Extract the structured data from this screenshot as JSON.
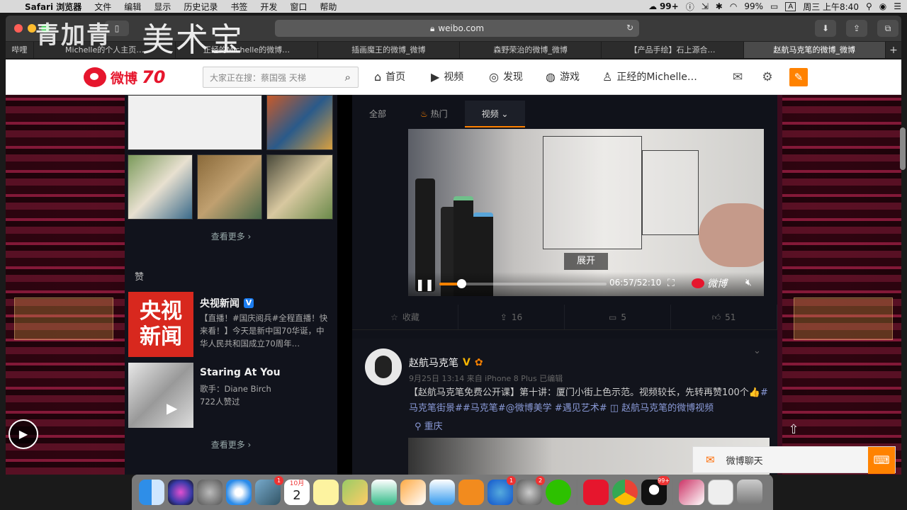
{
  "menubar": {
    "items": [
      "Safari 浏览器",
      "文件",
      "编辑",
      "显示",
      "历史记录",
      "书签",
      "开发",
      "窗口",
      "帮助"
    ],
    "notif_count": "99+",
    "battery": "99%",
    "input_method": "A",
    "clock": "周三 上午8:40"
  },
  "browser": {
    "url": "weibo.com",
    "tabs": [
      "哔哩",
      "Michelle的个人主页…",
      "正经的Michelle的微博…",
      "插画魔王的微博_微博",
      "森野荣治的微博_微博",
      "【产品手绘】石上源合…",
      "赵航马克笔的微博_微博"
    ],
    "active_tab_index": 6
  },
  "watermark": {
    "left": "青加青",
    "right": "美术宝"
  },
  "weibo_nav": {
    "logo_text": "微博",
    "logo_number": "70",
    "search_placeholder": "大家正在搜：蔡国强 天梯",
    "home": "首页",
    "video": "视频",
    "discover": "发现",
    "games": "游戏",
    "profile": "正经的Michelle…"
  },
  "left": {
    "more1": "查看更多 ›",
    "zan_title": "赞",
    "rec1": {
      "name": "央视新闻",
      "desc": "【直播！#国庆阅兵#全程直播！快来看！】今天是新中国70华诞，中华人民共和国成立70周年…",
      "img_text1": "央视",
      "img_text2": "新闻"
    },
    "rec2": {
      "name": "Staring At You",
      "desc1": "歌手：Diane Birch",
      "desc2": "722人赞过"
    },
    "more2": "查看更多 ›"
  },
  "feed": {
    "tabs": [
      "全部",
      "热门",
      "视频 ⌄"
    ],
    "video": {
      "expand_label": "展开",
      "time": "06:57/52:10",
      "progress_percent": 13,
      "brand": "微博"
    },
    "actions": {
      "fav": "收藏",
      "repost": "16",
      "comment": "5",
      "like": "51"
    },
    "post": {
      "author": "赵航马克笔",
      "verified": "V",
      "meta": "9月25日 13:14 来自 iPhone 8 Plus  已编辑",
      "text": "【赵航马克笔免费公开课】第十讲：厦门小街上色示范。视频较长，先转再赞100个👍",
      "tags": "#马克笔街景##马克笔#@微博美学 #遇见艺术# ◫ 赵航马克笔的微博视频",
      "location": "重庆"
    }
  },
  "chat": {
    "label": "微博聊天"
  },
  "dock": {
    "badges": {
      "apps_store": "1",
      "settings": "2",
      "qq": "99+",
      "photos": "1"
    },
    "calendar_month": "10月",
    "calendar_day": "2"
  },
  "colors": {
    "accent": "#ff8200",
    "weibo_red": "#e6162d",
    "bg_dark": "#10121a"
  }
}
